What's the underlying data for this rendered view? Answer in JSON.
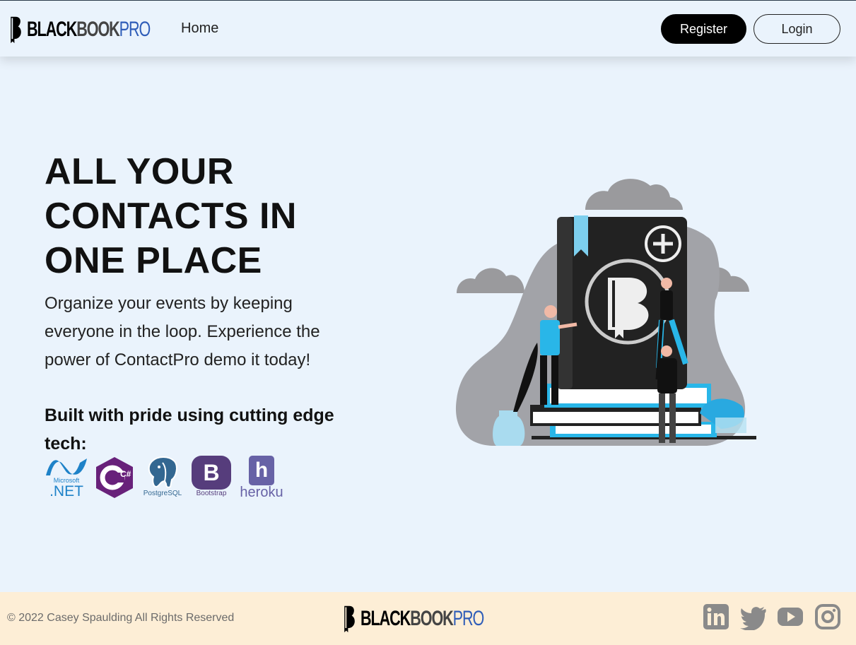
{
  "nav": {
    "logo_part1": "BLACK",
    "logo_part2": "BOOK",
    "logo_part3": "PRO",
    "home_label": "Home",
    "register_label": "Register",
    "login_label": "Login"
  },
  "hero": {
    "title": "ALL YOUR CONTACTS IN ONE PLACE",
    "text": "Organize your events by keeping everyone in the loop. Experience the power of ContactPro demo it today!",
    "tech_heading": "Built with pride using cutting edge tech:",
    "tech": [
      {
        "icon": "dotnet-icon",
        "caption_small": "Microsoft",
        "caption": ".NET",
        "color": "#1e82c8"
      },
      {
        "icon": "csharp-icon",
        "caption": "C#",
        "color": "#68217a"
      },
      {
        "icon": "postgresql-icon",
        "caption": "PostgreSQL",
        "color": "#336791"
      },
      {
        "icon": "bootstrap-icon",
        "caption_mark": "B",
        "caption": "Bootstrap",
        "color": "#563d7c"
      },
      {
        "icon": "heroku-icon",
        "caption_mark": "h",
        "caption": "heroku",
        "color": "#6762a6"
      }
    ]
  },
  "footer": {
    "copyright": "© 2022 Casey Spaulding All Rights Reserved",
    "social": [
      "linkedin-icon",
      "twitter-icon",
      "youtube-icon",
      "instagram-icon"
    ],
    "social_color": "#8a8a8a"
  },
  "colors": {
    "background": "#eaf3fc",
    "footer_bg": "#fdeed6",
    "brand_blue": "#2f5db8",
    "accent_cyan": "#29b6e8"
  }
}
